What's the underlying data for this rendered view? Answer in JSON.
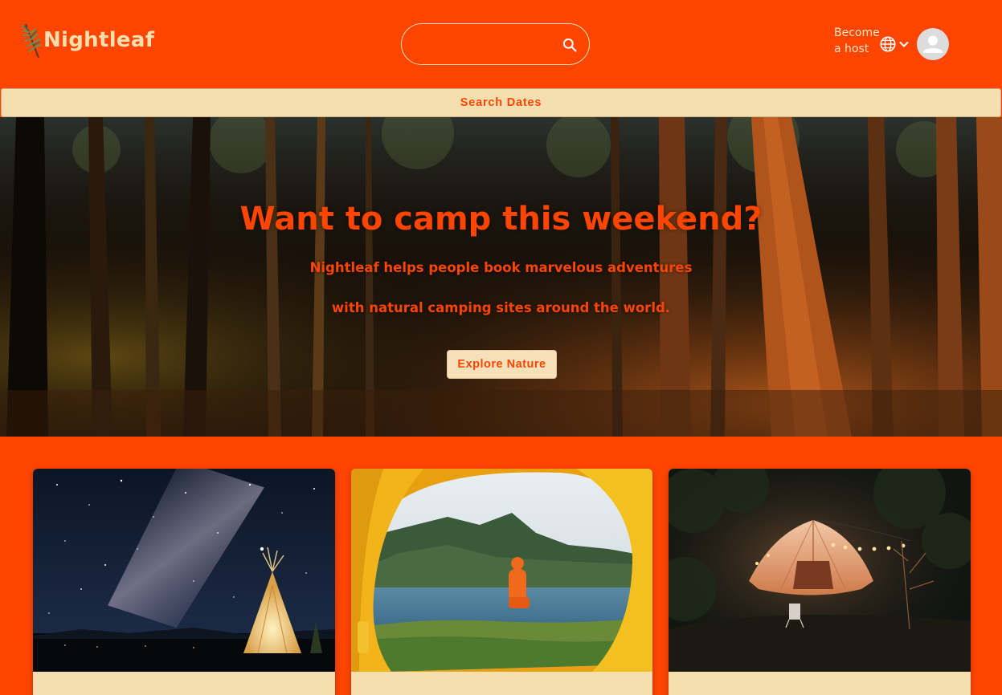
{
  "brand": {
    "name": "Nightleaf"
  },
  "search": {
    "placeholder": "",
    "value": ""
  },
  "header": {
    "host_link": "Become a host"
  },
  "dates_bar": {
    "label": "Search Dates"
  },
  "hero": {
    "title": "Want to camp this weekend?",
    "subtitle_line1": "Nightleaf helps people book marvelous adventures",
    "subtitle_line2": "with natural camping sites around the world.",
    "cta_label": "Explore Nature"
  },
  "colors": {
    "primary": "#ff4500",
    "cream": "#f5deb0",
    "avatar_bg": "#dcdcdc"
  },
  "icons": {
    "logo": "leaf-icon",
    "search": "search-icon",
    "language": "globe-icon",
    "language_menu": "chevron-down-icon",
    "account": "user-icon"
  },
  "cards": [
    {
      "image": "teepee-under-milky-way"
    },
    {
      "image": "view-from-yellow-tent-to-lake"
    },
    {
      "image": "lit-tent-at-night-forest"
    }
  ]
}
